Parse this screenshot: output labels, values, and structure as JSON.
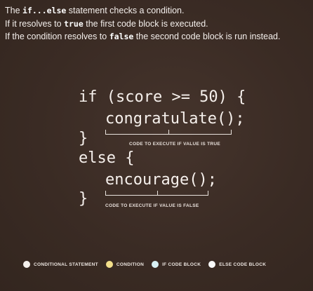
{
  "intro": {
    "line1": {
      "a": "The ",
      "kw": "if...else",
      "b": " statement checks a condition."
    },
    "line2": {
      "a": "If it resolves to ",
      "kw": "true",
      "b": " the first code block is executed."
    },
    "line3": {
      "a": "If the condition resolves to ",
      "kw": "false",
      "b": " the second code block is run instead."
    }
  },
  "code": {
    "line1": "if (score >= 50) {",
    "line2": "congratulate();",
    "line3": "}",
    "line4": "else {",
    "line5": "encourage();",
    "line6": "}"
  },
  "annotations": {
    "true_block": "CODE TO EXECUTE IF VALUE IS TRUE",
    "false_block": "CODE TO EXECUTE IF VALUE IS FALSE"
  },
  "legend": [
    {
      "label": "CONDITIONAL STATEMENT",
      "color": "#f4f0ec"
    },
    {
      "label": "CONDITION",
      "color": "#f3df8a"
    },
    {
      "label": "IF CODE BLOCK",
      "color": "#d8f0f4"
    },
    {
      "label": "ELSE CODE BLOCK",
      "color": "#fafafa"
    }
  ]
}
